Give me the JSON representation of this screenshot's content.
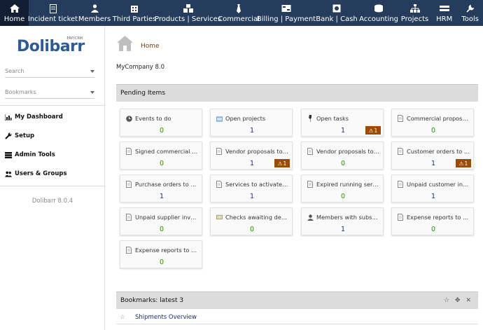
{
  "topnav": [
    {
      "label": "Home",
      "icon": "home-icon",
      "active": true
    },
    {
      "label": "Incident ticket",
      "icon": "ticket-icon"
    },
    {
      "label": "Members",
      "icon": "members-icon"
    },
    {
      "label": "Third Parties",
      "icon": "building-icon"
    },
    {
      "label": "Products | Services",
      "icon": "cubes-icon"
    },
    {
      "label": "Commercial",
      "icon": "tie-icon"
    },
    {
      "label": "Billing | Payment",
      "icon": "billing-icon"
    },
    {
      "label": "Bank | Cash",
      "icon": "bank-icon"
    },
    {
      "label": "Accounting",
      "icon": "accounting-icon"
    },
    {
      "label": "Projects",
      "icon": "sitemap-icon"
    },
    {
      "label": "HRM",
      "icon": "hrm-icon"
    },
    {
      "label": "Tools",
      "icon": "tools-icon"
    }
  ],
  "sidebar": {
    "logo_text": "Dolibarr",
    "logo_sub": "ERP/CRM",
    "search_placeholder": "Search",
    "bookmarks_placeholder": "Bookmarks",
    "items": [
      {
        "label": "My Dashboard",
        "icon": "chart-icon"
      },
      {
        "label": "Setup",
        "icon": "wrench-icon"
      },
      {
        "label": "Admin Tools",
        "icon": "server-icon"
      },
      {
        "label": "Users & Groups",
        "icon": "users-icon"
      }
    ],
    "version": "Dolibarr 8.0.4"
  },
  "breadcrumb": {
    "home": "Home"
  },
  "company": "MyCompany 8.0",
  "pending": {
    "title": "Pending Items",
    "boxes": [
      {
        "label": "Events to do",
        "value": "0",
        "color": "green",
        "icon": "clock-icon"
      },
      {
        "label": "Open projects",
        "value": "1",
        "color": "blue",
        "icon": "project-icon"
      },
      {
        "label": "Open tasks",
        "value": "1",
        "color": "blue",
        "icon": "task-icon",
        "warn": "1"
      },
      {
        "label": "Commercial proposals ...",
        "value": "0",
        "color": "green",
        "icon": "doc-icon"
      },
      {
        "label": "Signed commercial pro...",
        "value": "0",
        "color": "green",
        "icon": "doc-icon"
      },
      {
        "label": "Vendor proposals to cl...",
        "value": "1",
        "color": "blue",
        "icon": "doc-icon",
        "warn": "1"
      },
      {
        "label": "Vendor proposals to pr...",
        "value": "0",
        "color": "green",
        "icon": "doc-icon"
      },
      {
        "label": "Customer orders to pro...",
        "value": "1",
        "color": "blue",
        "icon": "doc-icon",
        "warn": "1"
      },
      {
        "label": "Purchase orders to pro...",
        "value": "1",
        "color": "blue",
        "icon": "doc-icon"
      },
      {
        "label": "Services to activate am...",
        "value": "1",
        "color": "blue",
        "icon": "doc-icon"
      },
      {
        "label": "Expired running services",
        "value": "0",
        "color": "green",
        "icon": "doc-icon"
      },
      {
        "label": "Unpaid customer invoi...",
        "value": "1",
        "color": "blue",
        "icon": "doc-icon"
      },
      {
        "label": "Unpaid supplier invoices",
        "value": "0",
        "color": "green",
        "icon": "doc-icon"
      },
      {
        "label": "Checks awaiting deposit",
        "value": "0",
        "color": "green",
        "icon": "cheque-icon"
      },
      {
        "label": "Members with subscrip...",
        "value": "1",
        "color": "blue",
        "icon": "user-icon"
      },
      {
        "label": "Expense reports to app...",
        "value": "0",
        "color": "green",
        "icon": "doc-icon"
      },
      {
        "label": "Expense reports to pay",
        "value": "0",
        "color": "green",
        "icon": "doc-icon"
      }
    ]
  },
  "bookmarks": {
    "title": "Bookmarks: latest 3",
    "items": [
      {
        "label": "Shipments Overview"
      }
    ]
  }
}
